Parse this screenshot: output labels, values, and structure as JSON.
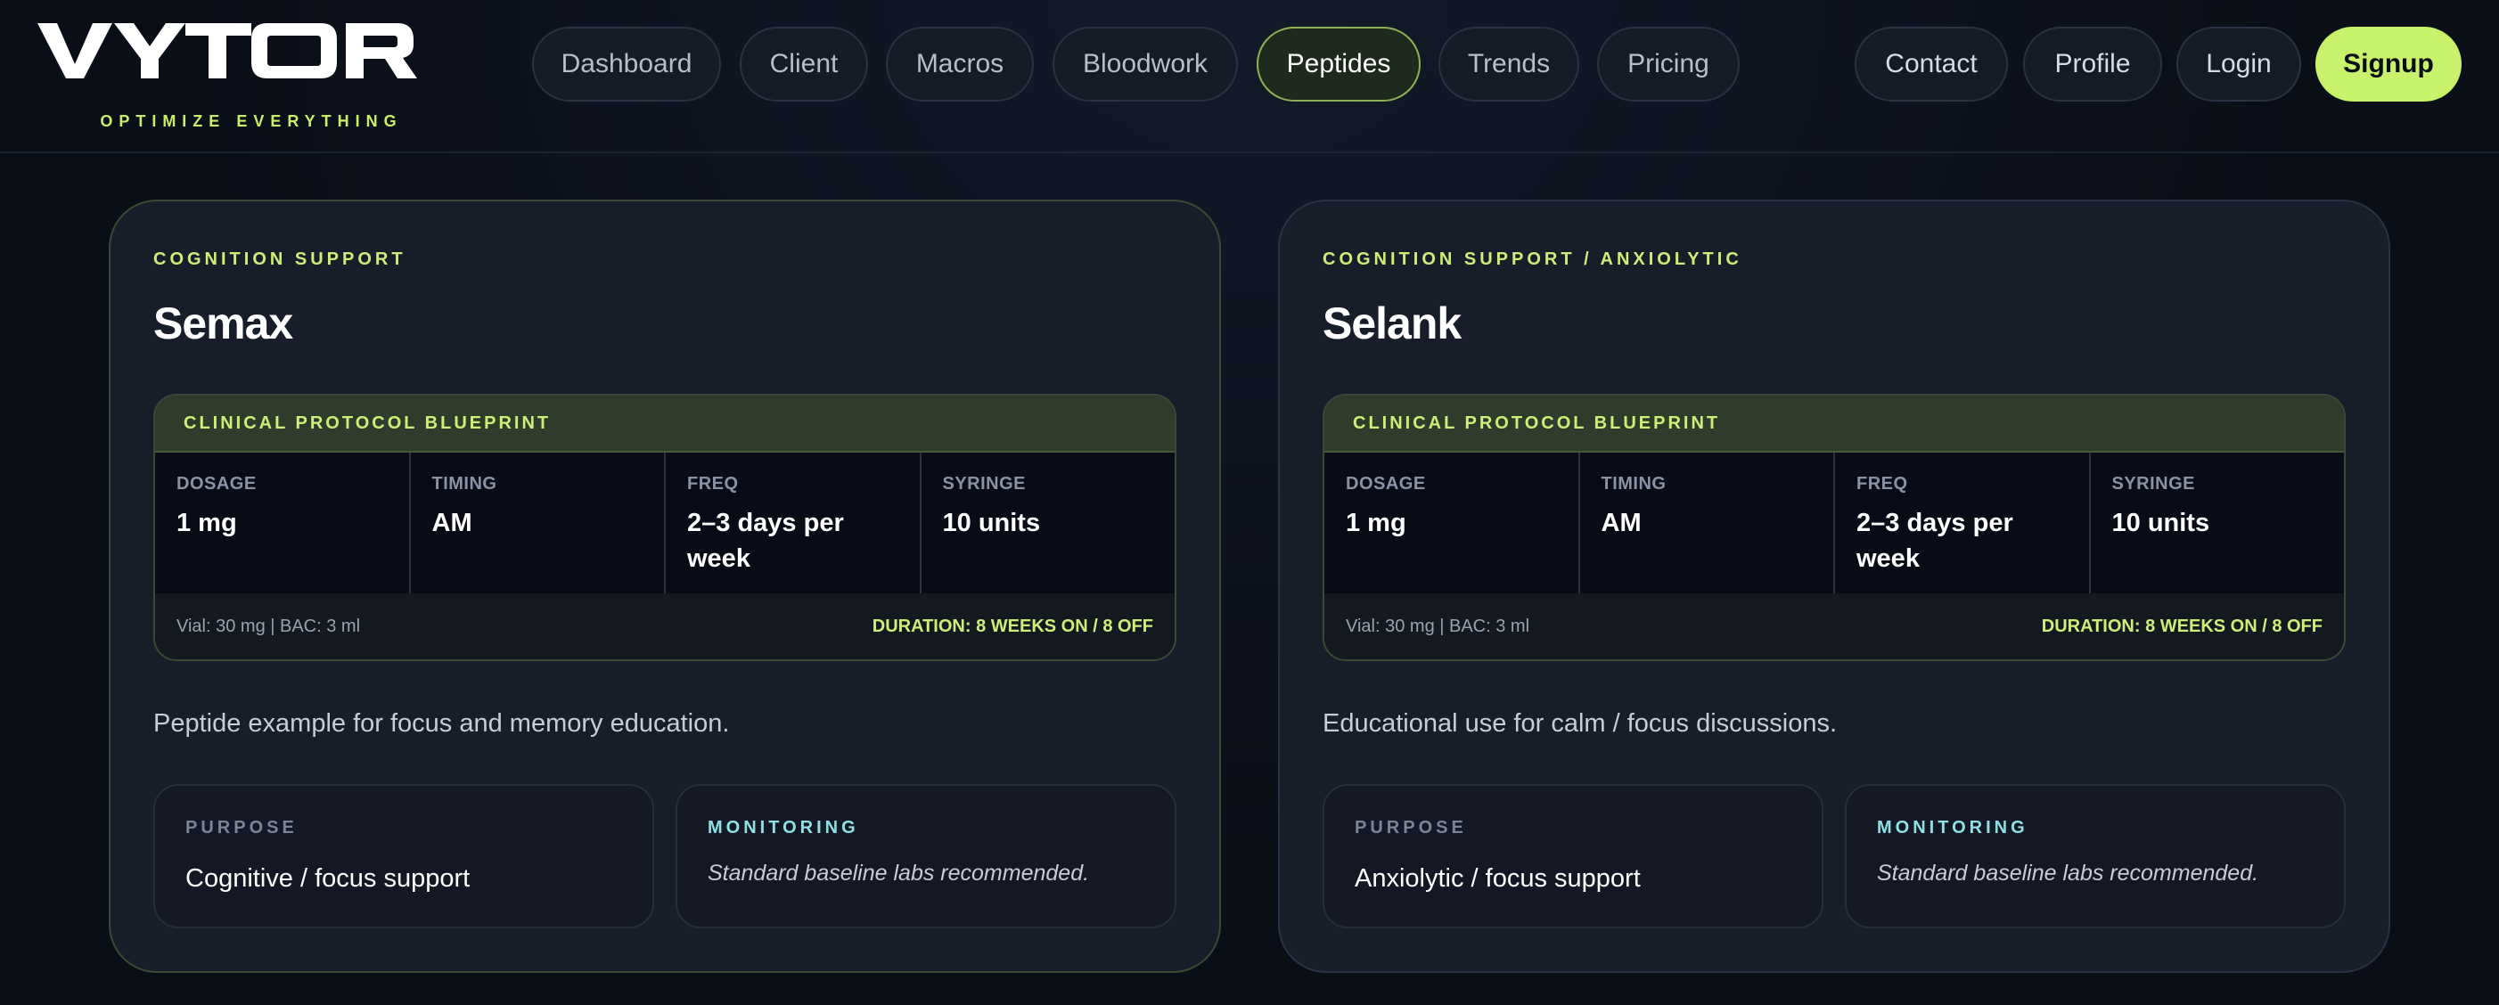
{
  "brand": {
    "name": "VYTOR",
    "tagline": "OPTIMIZE EVERYTHING",
    "accent": "#c8f26b"
  },
  "nav": {
    "main": [
      {
        "label": "Dashboard"
      },
      {
        "label": "Client"
      },
      {
        "label": "Macros"
      },
      {
        "label": "Bloodwork"
      },
      {
        "label": "Peptides",
        "active": true
      },
      {
        "label": "Trends"
      },
      {
        "label": "Pricing"
      }
    ],
    "right": [
      {
        "label": "Contact"
      },
      {
        "label": "Profile"
      },
      {
        "label": "Login"
      },
      {
        "label": "Signup"
      }
    ]
  },
  "cards": [
    {
      "category": "COGNITION SUPPORT",
      "name": "Semax",
      "protocol": {
        "header": "CLINICAL PROTOCOL BLUEPRINT",
        "dosage_label": "DOSAGE",
        "dosage": "1 mg",
        "timing_label": "TIMING",
        "timing": "AM",
        "freq_label": "FREQ",
        "freq": "2–3 days per week",
        "syringe_label": "SYRINGE",
        "syringe": "10 units",
        "vial": "Vial: 30 mg | BAC: 3 ml",
        "duration": "DURATION: 8 WEEKS ON / 8 OFF"
      },
      "description": "Peptide example for focus and memory education.",
      "purpose_label": "PURPOSE",
      "purpose": "Cognitive / focus support",
      "monitoring_label": "MONITORING",
      "monitoring": "Standard baseline labs recommended."
    },
    {
      "category": "COGNITION SUPPORT / ANXIOLYTIC",
      "name": "Selank",
      "protocol": {
        "header": "CLINICAL PROTOCOL BLUEPRINT",
        "dosage_label": "DOSAGE",
        "dosage": "1 mg",
        "timing_label": "TIMING",
        "timing": "AM",
        "freq_label": "FREQ",
        "freq": "2–3 days per week",
        "syringe_label": "SYRINGE",
        "syringe": "10 units",
        "vial": "Vial: 30 mg | BAC: 3 ml",
        "duration": "DURATION: 8 WEEKS ON / 8 OFF"
      },
      "description": "Educational use for calm / focus discussions.",
      "purpose_label": "PURPOSE",
      "purpose": "Anxiolytic / focus support",
      "monitoring_label": "MONITORING",
      "monitoring": "Standard baseline labs recommended."
    }
  ]
}
